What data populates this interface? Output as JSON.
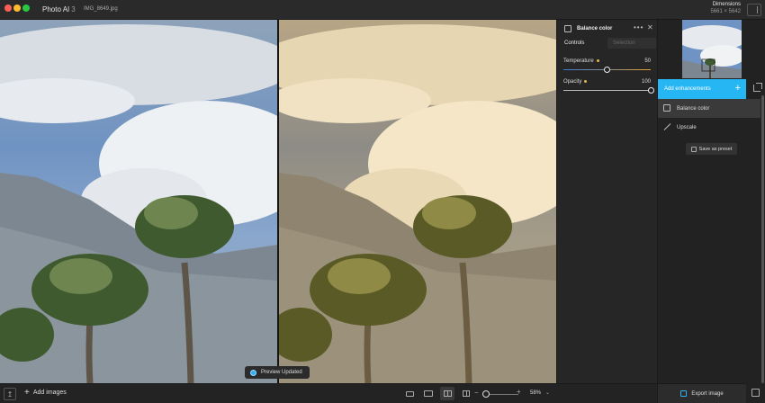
{
  "window": {
    "app_name": "Photo AI",
    "app_version": "3",
    "filename": "IMG_8649.jpg",
    "dimensions_label": "Dimensions",
    "dimensions_value": "5661 × 5642"
  },
  "viewer": {
    "toast": "Preview Updated",
    "left_image": "palm-trees-original",
    "right_image": "palm-trees-balanced-warm"
  },
  "bottom_bar": {
    "add_images_label": "Add images",
    "zoom_value": "58%",
    "zoom_level": 0.1
  },
  "controls": {
    "title": "Balance color",
    "tabs": [
      "Controls",
      "Selection"
    ],
    "sliders": [
      {
        "label": "Temperature",
        "value": "50",
        "fraction": 0.5
      },
      {
        "label": "Opacity",
        "value": "100",
        "fraction": 1.0
      }
    ]
  },
  "enhancements": {
    "add_label": "Add enhancements",
    "items": [
      {
        "label": "Balance color",
        "icon": "balance-color-icon",
        "selected": true
      },
      {
        "label": "Upscale",
        "icon": "upscale-icon",
        "selected": false
      }
    ],
    "save_preset_label": "Save as preset",
    "export_label": "Export image"
  },
  "colors": {
    "accent": "#27b6f4",
    "slider_dot": "#e4b84a"
  }
}
